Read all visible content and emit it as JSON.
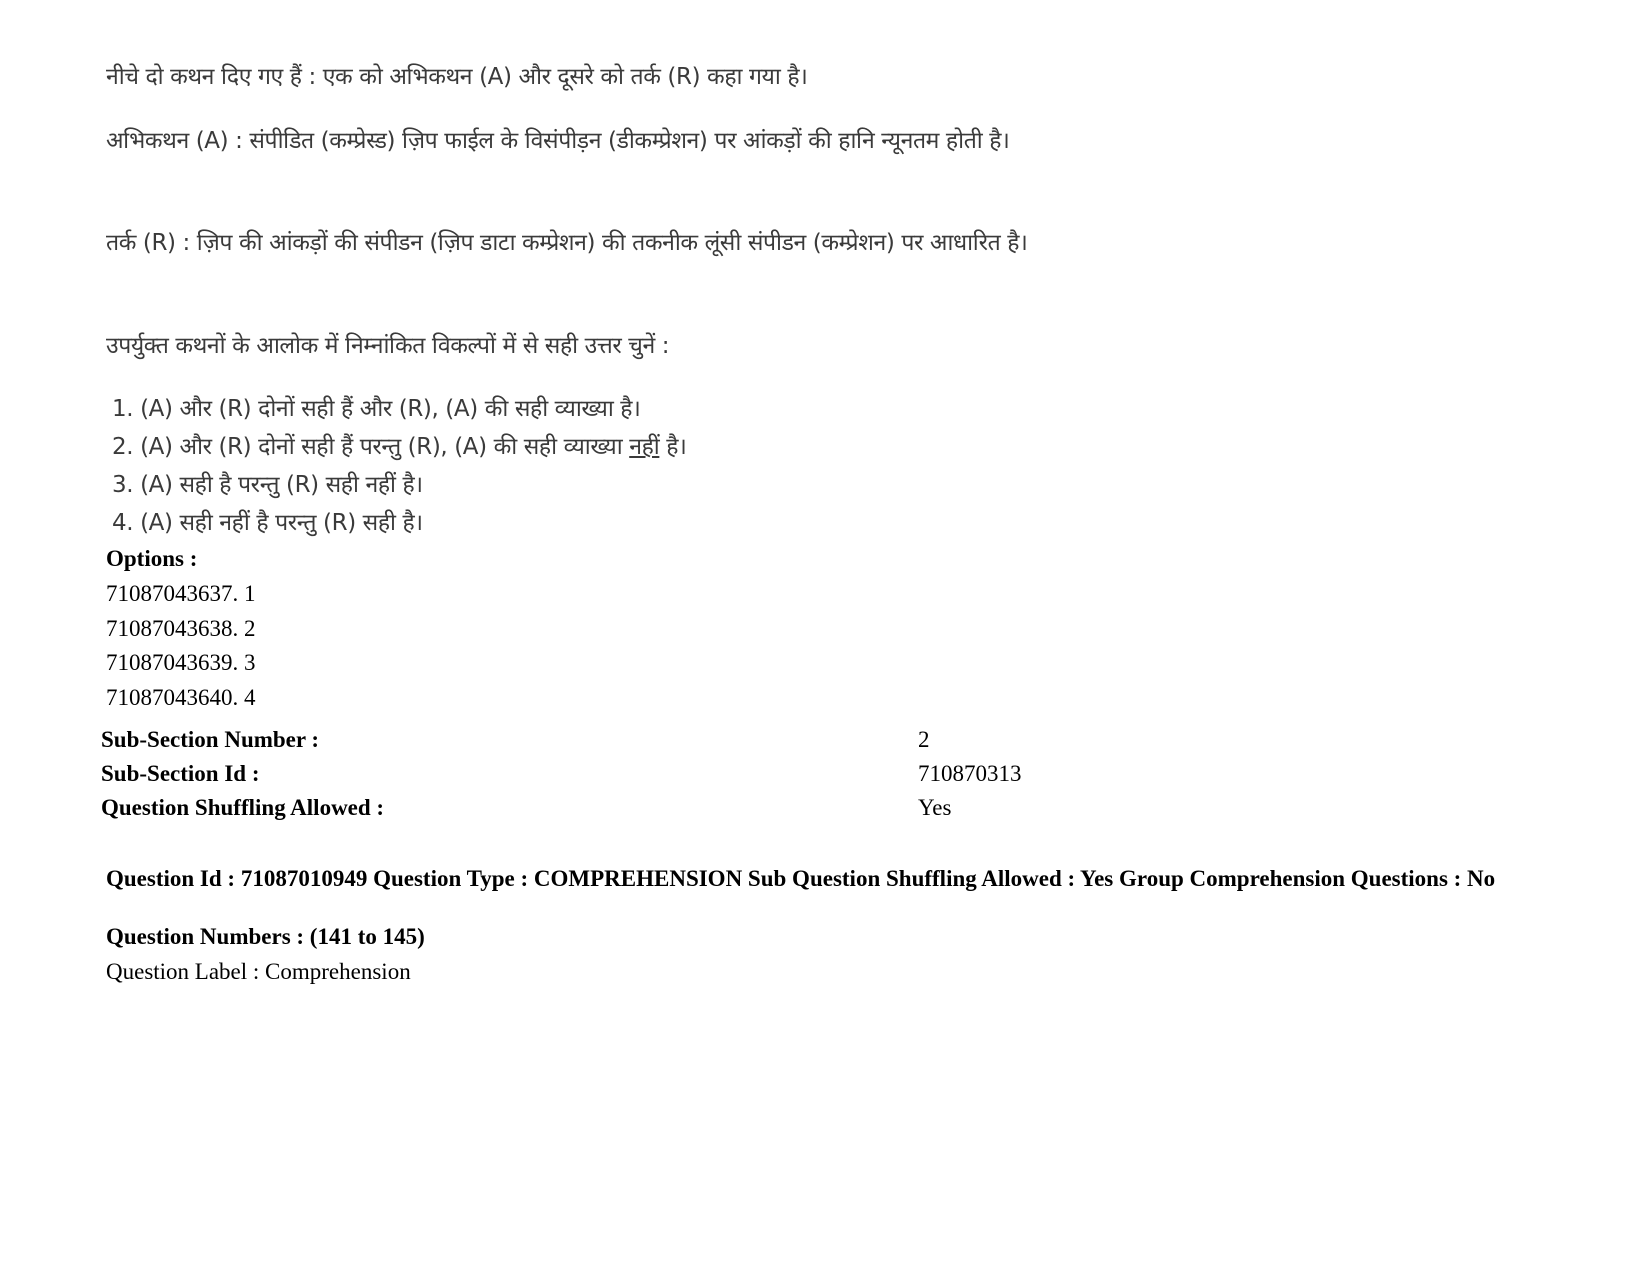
{
  "question": {
    "intro": "नीचे दो कथन दिए गए हैं :  एक को अभिकथन (A) और दूसरे को तर्क (R) कहा गया है।",
    "assertion": "अभिकथन (A) : संपीडित (कम्प्रेस्ड) ज़िप फाईल के विसंपीड़न (डीकम्प्रेशन) पर आंकड़ों की हानि न्यूनतम होती है।",
    "reason": "तर्क (R) : ज़िप की आंकड़ों की संपीडन (ज़िप डाटा कम्प्रेशन) की तकनीक लूंसी संपीडन (कम्प्रेशन) पर आधारित है।",
    "instruction": "उपर्युक्त कथनों के आलोक में निम्नांकित विकल्पों में से सही उत्तर चुनें :",
    "choices": [
      {
        "num": "1.",
        "text": "(A) और (R) दोनों सही हैं और (R), (A) की सही व्याख्या है।"
      },
      {
        "num": "2.",
        "text_before": "(A) और (R) दोनों सही हैं परन्तु (R), (A) की सही व्याख्या ",
        "text_underlined": "नहीं",
        "text_after": " है।"
      },
      {
        "num": "3.",
        "text": "(A) सही है परन्तु (R) सही नहीं है।"
      },
      {
        "num": "4.",
        "text": "(A) सही नहीं है परन्तु (R) सही है।"
      }
    ]
  },
  "options": {
    "label": "Options :",
    "items": [
      "71087043637. 1",
      "71087043638. 2",
      "71087043639. 3",
      "71087043640. 4"
    ]
  },
  "subsection": {
    "number_label": "Sub-Section Number :",
    "number_value": "2",
    "id_label": "Sub-Section Id :",
    "id_value": "710870313",
    "shuffle_label": "Question Shuffling Allowed :",
    "shuffle_value": "Yes"
  },
  "next_question": {
    "header": "Question Id : 71087010949 Question Type : COMPREHENSION Sub Question Shuffling Allowed : Yes Group Comprehension Questions : No",
    "numbers": "Question Numbers : (141 to 145)",
    "label": "Question Label : Comprehension"
  }
}
